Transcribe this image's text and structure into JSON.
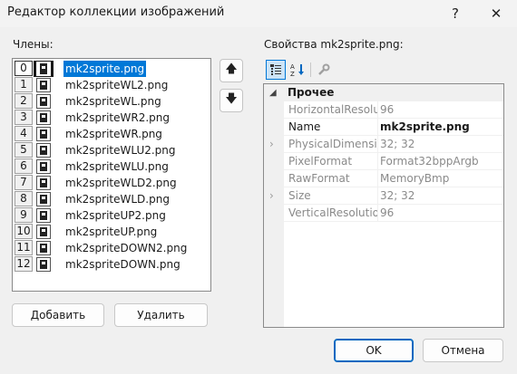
{
  "window": {
    "title": "Редактор коллекции изображений",
    "help_glyph": "?",
    "close_glyph": "✕"
  },
  "members": {
    "label": "Члены:",
    "items": [
      {
        "index": "0",
        "name": "mk2sprite.png"
      },
      {
        "index": "1",
        "name": "mk2spriteWL2.png"
      },
      {
        "index": "2",
        "name": "mk2spriteWL.png"
      },
      {
        "index": "3",
        "name": "mk2spriteWR2.png"
      },
      {
        "index": "4",
        "name": "mk2spriteWR.png"
      },
      {
        "index": "5",
        "name": "mk2spriteWLU2.png"
      },
      {
        "index": "6",
        "name": "mk2spriteWLU.png"
      },
      {
        "index": "7",
        "name": "mk2spriteWLD2.png"
      },
      {
        "index": "8",
        "name": "mk2spriteWLD.png"
      },
      {
        "index": "9",
        "name": "mk2spriteUP2.png"
      },
      {
        "index": "10",
        "name": "mk2spriteUP.png"
      },
      {
        "index": "11",
        "name": "mk2spriteDOWN2.png"
      },
      {
        "index": "12",
        "name": "mk2spriteDOWN.png"
      }
    ],
    "selected_index": 0,
    "move_up_glyph": "🡅",
    "move_down_glyph": "🡇"
  },
  "buttons": {
    "add": "Добавить",
    "remove": "Удалить",
    "ok": "OK",
    "cancel": "Отмена"
  },
  "properties": {
    "label": "Свойства mk2sprite.png:",
    "toolbar": {
      "categorized_icon": "categorized-icon",
      "alphabetical_icon": "alphabetical-icon",
      "property_pages_icon": "wrench-icon"
    },
    "category": {
      "toggle": "◢",
      "name": "Прочее"
    },
    "rows": [
      {
        "key": "HorizontalResolution",
        "value": "96",
        "expandable": false,
        "active": false
      },
      {
        "key": "Name",
        "value": "mk2sprite.png",
        "expandable": false,
        "active": true
      },
      {
        "key": "PhysicalDimension",
        "value": "32; 32",
        "expandable": true,
        "active": false
      },
      {
        "key": "PixelFormat",
        "value": "Format32bppArgb",
        "expandable": false,
        "active": false
      },
      {
        "key": "RawFormat",
        "value": "MemoryBmp",
        "expandable": false,
        "active": false
      },
      {
        "key": "Size",
        "value": "32; 32",
        "expandable": true,
        "active": false
      },
      {
        "key": "VerticalResolution",
        "value": "96",
        "expandable": false,
        "active": false
      }
    ]
  },
  "colors": {
    "selection": "#0078d7",
    "background": "#f0f0f0"
  }
}
